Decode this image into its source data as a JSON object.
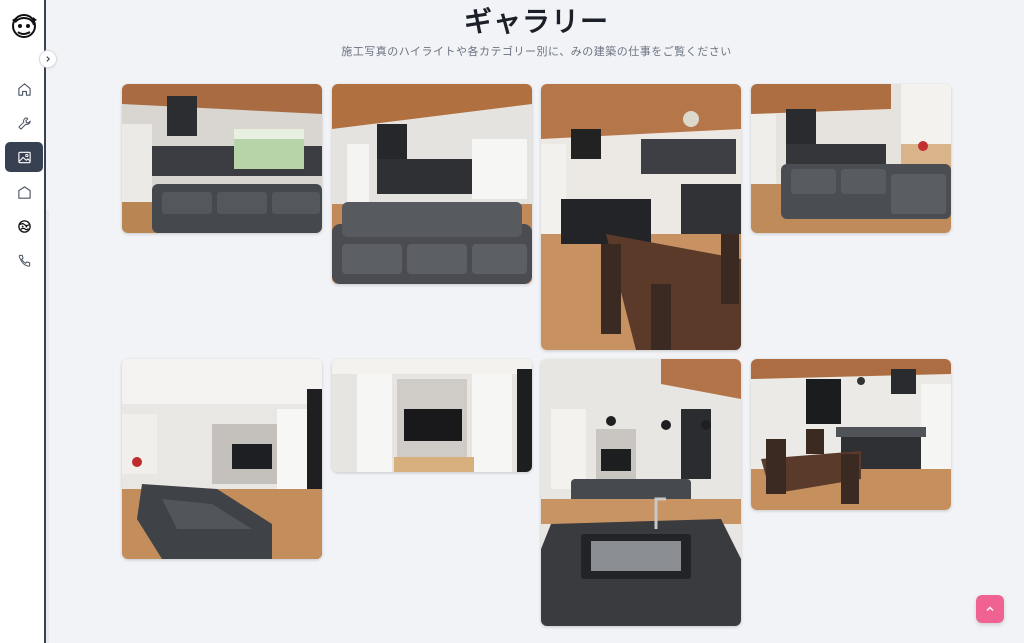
{
  "header": {
    "title": "ギャラリー",
    "subtitle": "施工写真のハイライトや各カテゴリー別に、みの建築の仕事をご覧ください"
  },
  "sidebar": {
    "items": [
      {
        "icon": "home-icon"
      },
      {
        "icon": "wrench-icon"
      },
      {
        "icon": "gallery-icon",
        "active": true
      },
      {
        "icon": "house-icon"
      },
      {
        "icon": "globe-icon"
      },
      {
        "icon": "phone-icon"
      }
    ],
    "collapse_icon": "chevron-right-icon"
  },
  "gallery": {
    "photos": [
      {
        "name": "living-room-sofa-kitchen"
      },
      {
        "name": "living-room-sofa-wide"
      },
      {
        "name": "kitchen-island-dining-table"
      },
      {
        "name": "living-room-corner-sofa"
      },
      {
        "name": "living-room-tv-sofa"
      },
      {
        "name": "tv-wall-closet"
      },
      {
        "name": "kitchen-sink-living-view"
      },
      {
        "name": "kitchen-dining-set"
      }
    ]
  },
  "colors": {
    "background": "#f1f3f6",
    "sidebar_active": "#374151",
    "scroll_top": "#f06292"
  }
}
